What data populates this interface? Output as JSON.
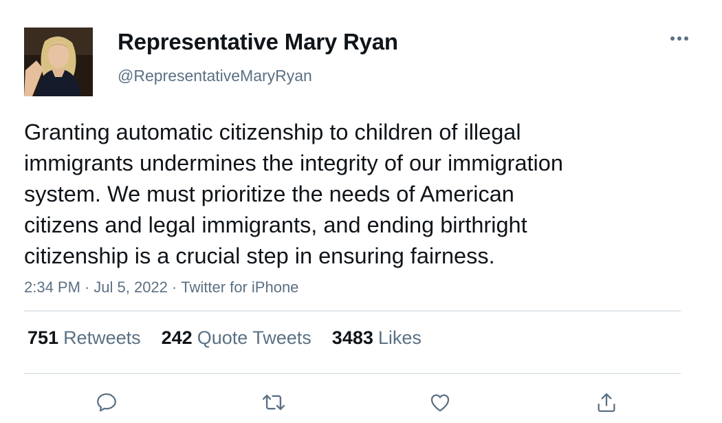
{
  "author": {
    "display_name": "Representative Mary Ryan",
    "handle": "@RepresentativeMaryRyan",
    "avatar_icon": "profile-photo"
  },
  "tweet": {
    "text": "Granting automatic citizenship to children of illegal\nimmigrants undermines the integrity of our immigration\nsystem. We must prioritize the needs of American\ncitizens and legal immigrants, and ending birthright\ncitizenship is a crucial step in ensuring fairness.",
    "time": "2:34 PM",
    "separator": "·",
    "date": "Jul 5, 2022",
    "source": "Twitter for iPhone"
  },
  "stats": {
    "retweets_count": "751",
    "retweets_label": "Retweets",
    "quotes_count": "242",
    "quotes_label": "Quote Tweets",
    "likes_count": "3483",
    "likes_label": "Likes"
  },
  "actions": {
    "reply_icon": "reply-icon",
    "retweet_icon": "retweet-icon",
    "like_icon": "heart-icon",
    "share_icon": "share-icon"
  },
  "colors": {
    "primary_text": "#0f1419",
    "secondary_text": "#5b7083",
    "divider": "#e1e6ea"
  }
}
